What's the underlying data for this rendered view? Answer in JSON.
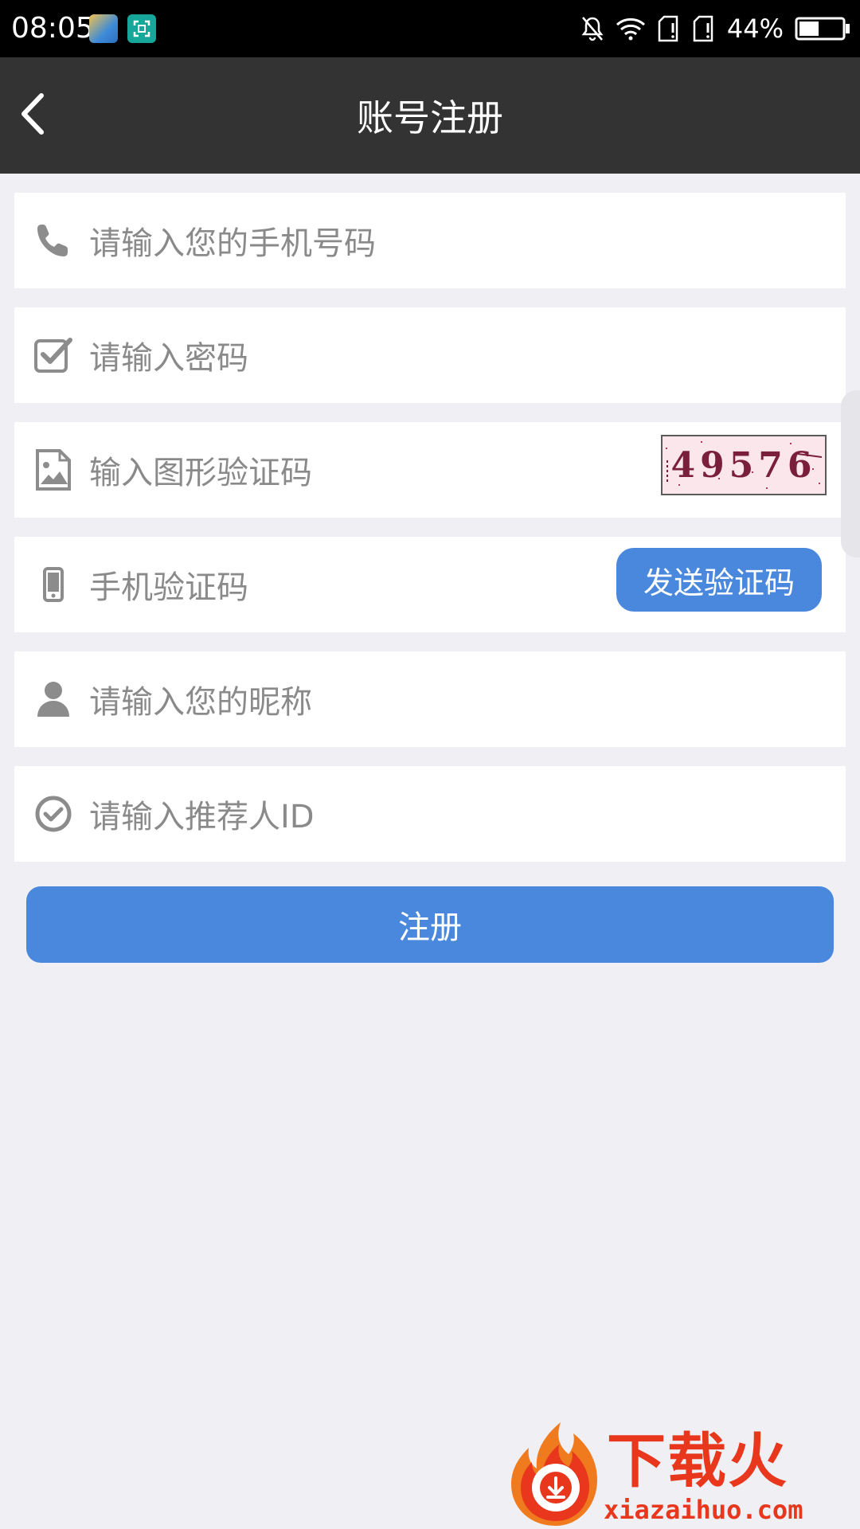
{
  "status_bar": {
    "time": "08:05",
    "battery": "44%",
    "icons": [
      "weather-app-icon",
      "screenshot-app-icon",
      "bell-off-icon",
      "wifi-icon",
      "sim1-icon",
      "sim2-icon",
      "battery-icon"
    ]
  },
  "nav": {
    "title": "账号注册"
  },
  "form": {
    "phone": {
      "placeholder": "请输入您的手机号码",
      "icon": "phone-icon"
    },
    "password": {
      "placeholder": "请输入密码",
      "icon": "checkbox-icon"
    },
    "image_captcha": {
      "placeholder": "输入图形验证码",
      "icon": "image-icon",
      "captcha_text": "49576"
    },
    "sms_code": {
      "placeholder": "手机验证码",
      "icon": "mobile-icon",
      "send_label": "发送验证码"
    },
    "nickname": {
      "placeholder": "请输入您的昵称",
      "icon": "user-icon"
    },
    "referrer": {
      "placeholder": "请输入推荐人ID",
      "icon": "check-circle-icon"
    }
  },
  "register_label": "注册",
  "watermark": {
    "brand": "下载火",
    "url": "xiazaihuo.com"
  },
  "colors": {
    "nav_bg": "#333333",
    "page_bg": "#EFEFF4",
    "accent": "#4A88DE",
    "placeholder": "#8A8A8A",
    "icon": "#8C8C8C",
    "watermark": "#E8371D"
  }
}
